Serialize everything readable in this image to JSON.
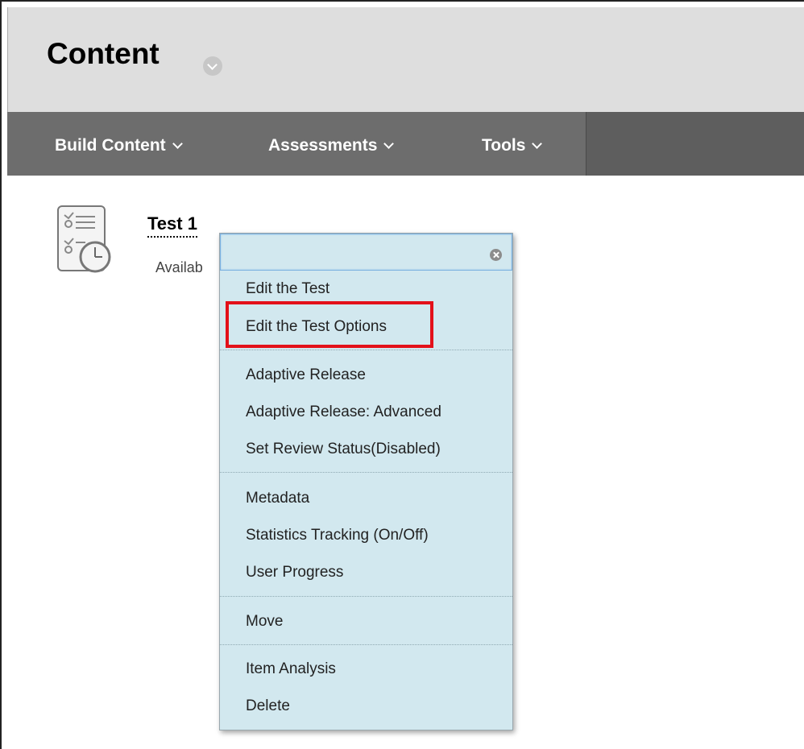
{
  "header": {
    "title": "Content"
  },
  "toolbar": {
    "items": [
      {
        "label": "Build Content"
      },
      {
        "label": "Assessments"
      },
      {
        "label": "Tools"
      }
    ]
  },
  "content_item": {
    "title": "Test 1",
    "subtitle": "Availab"
  },
  "context_menu": {
    "groups": [
      [
        "Edit the Test",
        "Edit the Test Options"
      ],
      [
        "Adaptive Release",
        "Adaptive Release: Advanced",
        "Set Review Status(Disabled)"
      ],
      [
        "Metadata",
        "Statistics Tracking (On/Off)",
        "User Progress"
      ],
      [
        "Move"
      ],
      [
        "Item Analysis",
        "Delete"
      ]
    ],
    "highlighted_item": "Edit the Test Options"
  },
  "colors": {
    "header_bg": "#dedede",
    "toolbar_bg": "#6d6d6d",
    "menu_bg": "#d2e8ef",
    "highlight": "#e3111a"
  }
}
